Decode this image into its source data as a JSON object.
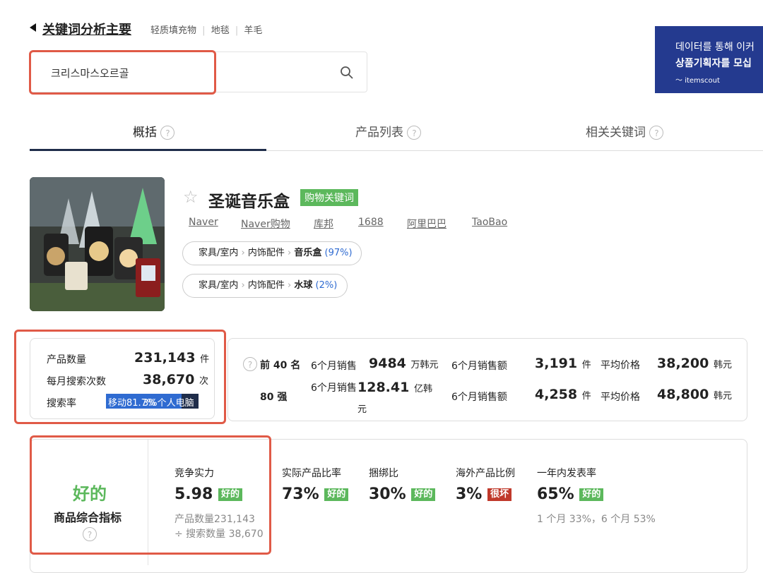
{
  "header": {
    "back_title": "关键词分析主要",
    "related": [
      "轻质填充物",
      "地毯",
      "羊毛"
    ]
  },
  "search": {
    "value": "크리스마스오르골",
    "placeholder": ""
  },
  "ad": {
    "line1": "데이터를 통해 이커",
    "line2": "상품기획자를 모십",
    "brand": "itemscout"
  },
  "tabs": [
    {
      "label": "概括"
    },
    {
      "label": "产品列表"
    },
    {
      "label": "相关关键词"
    }
  ],
  "keyword": {
    "title": "圣诞音乐盒",
    "tag": "购物关键词",
    "links": [
      "Naver",
      "Naver购物",
      "库邦",
      "1688",
      "阿里巴巴",
      "TaoBao"
    ],
    "categories": [
      {
        "c1": "家具/室内",
        "c2": "内饰配件",
        "c3": "音乐盒",
        "pct": "(97%)"
      },
      {
        "c1": "家具/室内",
        "c2": "内饰配件",
        "c3": "水球",
        "pct": "(2%)"
      }
    ]
  },
  "stats": {
    "product_count_label": "产品数量",
    "product_count": "231,143",
    "product_count_unit": "件",
    "monthly_search_label": "每月搜索次数",
    "monthly_search": "38,670",
    "monthly_search_unit": "次",
    "search_rate_label": "搜索率",
    "search_rate_bar": "移动81.7%",
    "search_rate_bar_overlay": "3%个人电脑",
    "search_rate_share": 0.817
  },
  "sales": {
    "rows": [
      {
        "rank": "前 40 名",
        "label1": "6个月销售",
        "value1": "9484",
        "unit1": "万韩元",
        "label2": "6个月销售额",
        "value2": "3,191",
        "unit2": "件",
        "label3": "平均价格",
        "value3": "38,200",
        "unit3": "韩元"
      },
      {
        "rank": "80 强",
        "label1": "6个月销售",
        "value1": "128.41",
        "unit1": "亿韩元",
        "label2": "6个月销售额",
        "value2": "4,258",
        "unit2": "件",
        "label3": "平均价格",
        "value3": "48,800",
        "unit3": "韩元"
      }
    ]
  },
  "metrics": {
    "overall_grade": "好的",
    "overall_label": "商品综合指标",
    "competition_label": "竞争实力",
    "competition_value": "5.98",
    "competition_badge": "好的",
    "competition_note1": "产品数量231,143",
    "competition_note2": "÷ 搜索数量 38,670",
    "items": [
      {
        "label": "实际产品比率",
        "value": "73%",
        "badge": "好的",
        "color": "#5cb85c"
      },
      {
        "label": "捆绑比",
        "value": "30%",
        "badge": "好的",
        "color": "#5cb85c"
      },
      {
        "label": "海外产品比例",
        "value": "3%",
        "badge": "很坏",
        "color": "#c0392b"
      },
      {
        "label": "一年内发表率",
        "value": "65%",
        "badge": "好的",
        "color": "#5cb85c"
      }
    ],
    "year_note": "1 个月 33%，6 个月 53%"
  },
  "colors": {
    "accent_green": "#5cb85c",
    "bad_red": "#c0392b",
    "link_blue": "#2f6bd1",
    "highlight_red": "#e05a47",
    "tab_underline": "#1f2d4a",
    "ad_bg": "#243a8f"
  }
}
